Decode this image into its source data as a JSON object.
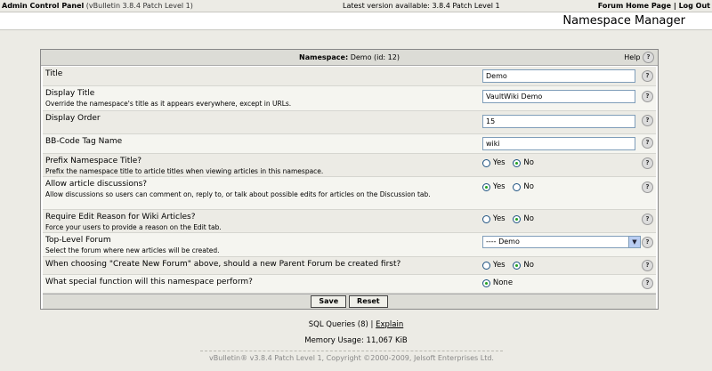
{
  "topbar": {
    "app": "Admin Control Panel",
    "version": "(vBulletin 3.8.4 Patch Level 1)",
    "latest": "Latest version available: 3.8.4 Patch Level 1",
    "forum_home": "Forum Home Page",
    "separator": "|",
    "logout": "Log Out"
  },
  "page_title": "Namespace Manager",
  "panel": {
    "head_label": "Namespace:",
    "head_value": "Demo (id: 12)",
    "help_label": "Help"
  },
  "rows": {
    "title": {
      "label": "Title",
      "value": "Demo"
    },
    "display_title": {
      "label": "Display Title",
      "desc": "Override the namespace's title as it appears everywhere, except in URLs.",
      "value": "VaultWiki Demo"
    },
    "display_order": {
      "label": "Display Order",
      "value": "15"
    },
    "bbcode": {
      "label": "BB-Code Tag Name",
      "value": "wiki"
    },
    "prefix": {
      "label": "Prefix Namespace Title?",
      "desc": "Prefix the namespace title to article titles when viewing articles in this namespace.",
      "selected": "No"
    },
    "discussions": {
      "label": "Allow article discussions?",
      "desc": "Allow discussions so users can comment on, reply to, or talk about possible edits for articles on the Discussion tab.",
      "selected": "Yes"
    },
    "edit_reason": {
      "label": "Require Edit Reason for Wiki Articles?",
      "desc": "Force your users to provide a reason on the Edit tab.",
      "selected": "No"
    },
    "forum": {
      "label": "Top-Level Forum",
      "desc": "Select the forum where new articles will be created.",
      "value": "---- Demo"
    },
    "parent_forum": {
      "label": "When choosing \"Create New Forum\" above, should a new Parent Forum be created first?",
      "selected": "No"
    },
    "special": {
      "label": "What special function will this namespace perform?",
      "option": "None"
    }
  },
  "radio_labels": {
    "yes": "Yes",
    "no": "No"
  },
  "buttons": {
    "save": "Save",
    "reset": "Reset"
  },
  "footer": {
    "sql": "SQL Queries (8)",
    "sep": "|",
    "explain": "Explain",
    "memory": "Memory Usage: 11,067 KiB",
    "copyright": "vBulletin® v3.8.4 Patch Level 1, Copyright ©2000-2009, Jelsoft Enterprises Ltd."
  },
  "icons": {
    "help": "question-icon",
    "dropdown": "chevron-down-icon"
  }
}
